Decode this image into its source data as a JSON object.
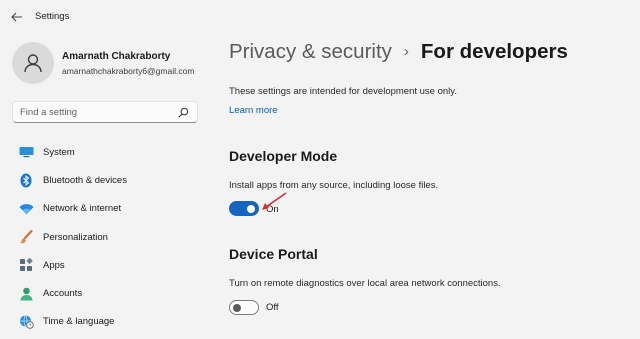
{
  "app": {
    "title": "Settings"
  },
  "profile": {
    "name": "Amarnath Chakraborty",
    "email": "amarnathchakraborty6@gmail.com"
  },
  "search": {
    "placeholder": "Find a setting",
    "icon": "search-icon"
  },
  "sidebar": {
    "items": [
      {
        "label": "System",
        "icon": "monitor-icon"
      },
      {
        "label": "Bluetooth & devices",
        "icon": "bluetooth-icon"
      },
      {
        "label": "Network & internet",
        "icon": "wifi-icon"
      },
      {
        "label": "Personalization",
        "icon": "brush-icon"
      },
      {
        "label": "Apps",
        "icon": "apps-icon"
      },
      {
        "label": "Accounts",
        "icon": "person-icon"
      },
      {
        "label": "Time & language",
        "icon": "globe-clock-icon"
      }
    ]
  },
  "breadcrumb": {
    "parent": "Privacy & security",
    "separator": "›",
    "current": "For developers"
  },
  "main": {
    "intro": "These settings are intended for development use only.",
    "learn_more": "Learn more",
    "developer_mode": {
      "title": "Developer Mode",
      "description": "Install apps from any source, including loose files.",
      "state": "On"
    },
    "device_portal": {
      "title": "Device Portal",
      "description": "Turn on remote diagnostics over local area network connections.",
      "state": "Off"
    }
  },
  "colors": {
    "accent": "#1565c0",
    "link": "#0a5ea8",
    "annotation_arrow": "#d32f2f"
  }
}
